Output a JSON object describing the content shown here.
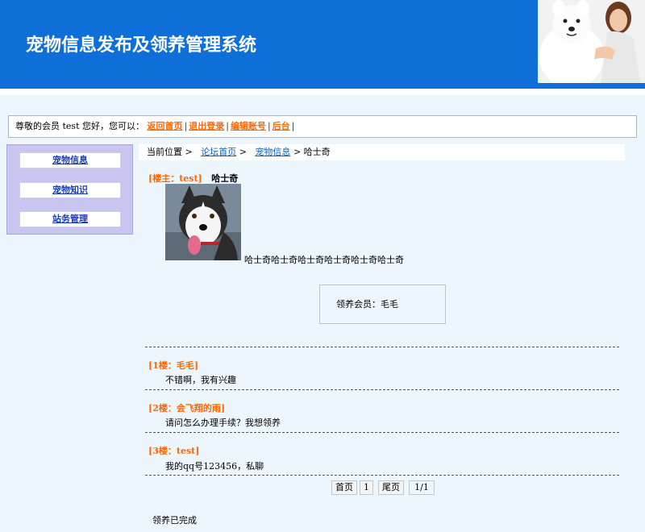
{
  "header": {
    "title": "宠物信息发布及领养管理系统"
  },
  "welcome": {
    "text": "尊敬的会员 test 您好，您可以：",
    "links": [
      "返回首页",
      "退出登录",
      "编辑账号",
      "后台"
    ]
  },
  "sidebar": {
    "items": [
      {
        "label": "宠物信息"
      },
      {
        "label": "宠物知识"
      },
      {
        "label": "站务管理"
      }
    ]
  },
  "breadcrumb": {
    "prefix": "当前位置 >",
    "link1": "论坛首页",
    "sep": ">",
    "link2": "宠物信息",
    "current": "> 哈士奇"
  },
  "post": {
    "owner_label": "[楼主：test]",
    "title": "哈士奇",
    "body": "哈士奇哈士奇哈士奇哈士奇哈士奇哈士奇",
    "adopter": "领养会员：毛毛"
  },
  "replies": [
    {
      "head": "[1楼：毛毛]",
      "body": "不错啊，我有兴趣"
    },
    {
      "head": "[2楼：会飞翔的雨]",
      "body": "请问怎么办理手续？我想领养"
    },
    {
      "head": "[3楼：test]",
      "body": "我的qq号123456，私聊"
    }
  ],
  "pager": {
    "first": "首页",
    "page": "1",
    "last": "尾页",
    "count": "1/1"
  },
  "status": "领养已完成",
  "colors": {
    "header_bg": "#0f6fd8",
    "accent": "#ff6600",
    "link": "#0b62c4",
    "sidebar_bg": "#c8c6f0"
  }
}
